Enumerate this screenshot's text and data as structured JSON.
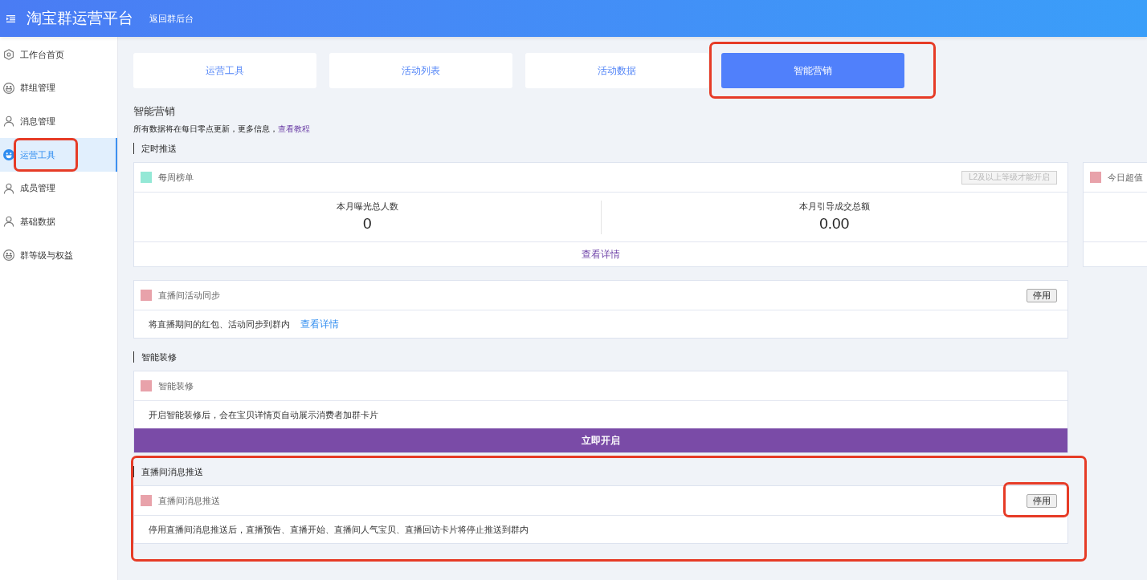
{
  "header": {
    "title": "淘宝群运营平台",
    "back_link": "返回群后台"
  },
  "sidebar": {
    "items": [
      {
        "label": "工作台首页",
        "selected": false,
        "highlighted": false
      },
      {
        "label": "群组管理",
        "selected": false,
        "highlighted": false
      },
      {
        "label": "消息管理",
        "selected": false,
        "highlighted": false
      },
      {
        "label": "运营工具",
        "selected": true,
        "highlighted": true
      },
      {
        "label": "成员管理",
        "selected": false,
        "highlighted": false
      },
      {
        "label": "基础数据",
        "selected": false,
        "highlighted": false
      },
      {
        "label": "群等级与权益",
        "selected": false,
        "highlighted": false
      }
    ]
  },
  "tabs": [
    {
      "label": "运营工具",
      "selected": false,
      "highlighted": false
    },
    {
      "label": "活动列表",
      "selected": false,
      "highlighted": false
    },
    {
      "label": "活动数据",
      "selected": false,
      "highlighted": false
    },
    {
      "label": "智能营销",
      "selected": true,
      "highlighted": true
    }
  ],
  "page": {
    "title": "智能营销",
    "note": "所有数据将在每日零点更新，更多信息，",
    "note_link": "查看教程"
  },
  "sections": [
    {
      "label": "定时推送",
      "highlighted": false,
      "cards": [
        {
          "kind": "stats",
          "title": "每周榜单",
          "color": "#94e8d6",
          "header_button": {
            "label": "L2及以上等级才能开启",
            "disabled": true,
            "highlighted": false
          },
          "stats": [
            {
              "label": "本月曝光总人数",
              "value": "0"
            },
            {
              "label": "本月引导成交总额",
              "value": "0.00"
            }
          ],
          "footer_link": "查看详情"
        },
        {
          "kind": "stats",
          "title": "今日超值",
          "color": "#e8a2aa"
        },
        {
          "kind": "text",
          "title": "直播间活动同步",
          "color": "#e8a2aa",
          "header_button": {
            "label": "停用",
            "disabled": false,
            "highlighted": false
          },
          "text": "将直播期间的红包、活动同步到群内",
          "link": "查看详情"
        }
      ]
    },
    {
      "label": "智能装修",
      "highlighted": false,
      "cards": [
        {
          "kind": "action",
          "title": "智能装修",
          "color": "#e8a2aa",
          "text": "开启智能装修后，会在宝贝详情页自动展示消费者加群卡片",
          "action": "立即开启"
        }
      ]
    },
    {
      "label": "直播间消息推送",
      "highlighted": true,
      "cards": [
        {
          "kind": "text",
          "title": "直播间消息推送",
          "color": "#e8a2aa",
          "header_button": {
            "label": "停用",
            "disabled": false,
            "highlighted": true
          },
          "text": "停用直播间消息推送后，直播预告、直播开始、直播间人气宝贝、直播回访卡片将停止推送到群内"
        }
      ]
    }
  ]
}
